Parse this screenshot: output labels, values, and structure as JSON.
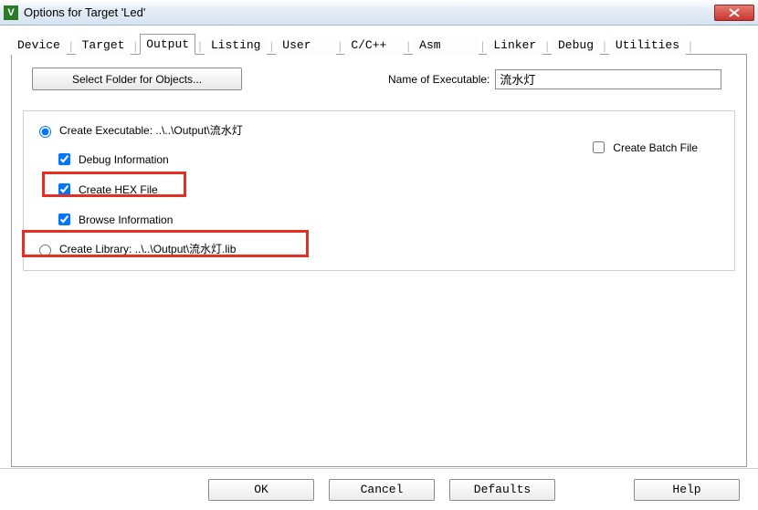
{
  "window": {
    "title": "Options for Target 'Led'"
  },
  "tabs": {
    "items": [
      "Device",
      "Target",
      "Output",
      "Listing",
      "User",
      "C/C++",
      "Asm",
      "Linker",
      "Debug",
      "Utilities"
    ],
    "active_index": 2
  },
  "row": {
    "select_folder_label": "Select Folder for Objects...",
    "name_of_executable_label": "Name of Executable:",
    "executable_name_value": "流水灯"
  },
  "options": {
    "create_executable_label": "Create Executable:  ..\\..\\Output\\流水灯",
    "debug_info_label": "Debug Information",
    "create_hex_label": "Create HEX File",
    "browse_info_label": "Browse Information",
    "create_library_label": "Create Library:  ..\\..\\Output\\流水灯.lib",
    "create_batch_label": "Create Batch File",
    "mode_selected": "executable",
    "debug_info_checked": true,
    "create_hex_checked": true,
    "browse_info_checked": true,
    "create_batch_checked": false
  },
  "footer": {
    "ok": "OK",
    "cancel": "Cancel",
    "defaults": "Defaults",
    "help": "Help"
  }
}
